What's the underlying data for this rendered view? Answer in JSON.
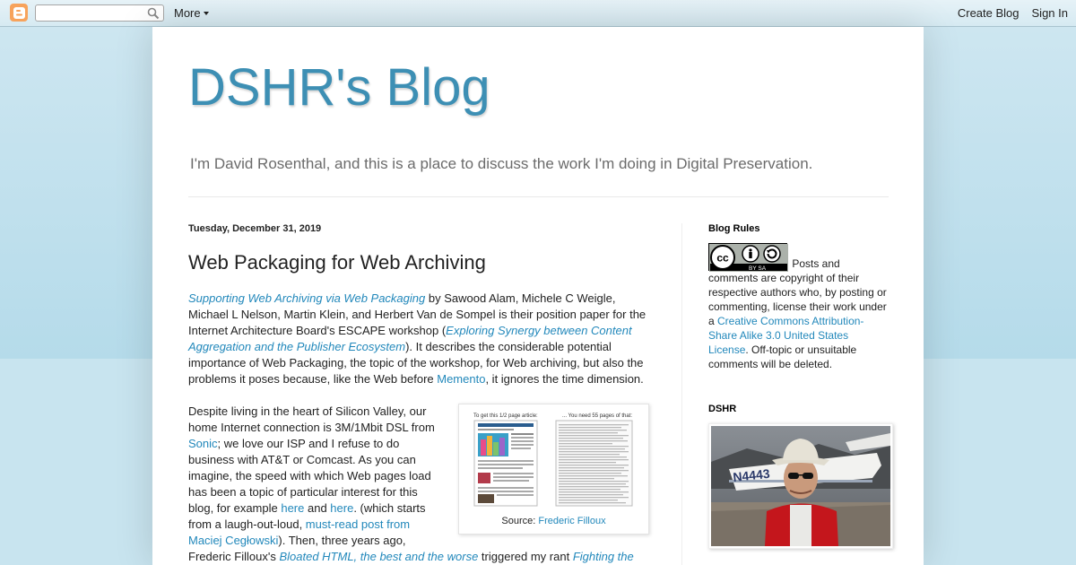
{
  "navbar": {
    "search_placeholder": "",
    "more_label": "More",
    "create_blog_label": "Create Blog",
    "sign_in_label": "Sign In"
  },
  "header": {
    "title": "DSHR's Blog",
    "description": "I'm David Rosenthal, and this is a place to discuss the work I'm doing in Digital Preservation."
  },
  "post": {
    "date": "Tuesday, December 31, 2019",
    "title": "Web Packaging for Web Archiving",
    "p1": {
      "link_title": "Supporting Web Archiving via Web Packaging",
      "t1": " by Sawood Alam, Michele C Weigle, Michael L Nelson, Martin Klein, and Herbert Van de Sompel is their position paper for the Internet Architecture Board's ESCAPE workshop (",
      "link_escape": "Exploring Synergy between Content Aggregation and the Publisher Ecosystem",
      "t2": "). It describes the considerable potential importance of Web Packaging, the topic of the workshop, for Web archiving, but also the problems it poses because, like the Web before ",
      "link_memento": "Memento",
      "t3": ", it ignores the time dimension."
    },
    "p2": {
      "t1": "Despite living in the heart of Silicon Valley, our home Internet connection is 3M/1Mbit DSL from ",
      "link_sonic": "Sonic",
      "t2": "; we love our ISP and I refuse to do business with AT&T or Comcast. As you can imagine, the speed with which Web pages load has been a topic of particular interest for this blog, for example ",
      "link_here1": "here",
      "t3": " and ",
      "link_here2": "here",
      "t4": ". (which starts from a laugh-out-loud, ",
      "link_maciej": "must-read post from Maciej Cegłowski",
      "t5": "). Then, three years ago, Frederic Filloux's ",
      "link_bloated": "Bloated HTML, the best and the worse",
      "t6": " triggered my rant ",
      "link_flab": "Fighting the Web Flab",
      "t7": ":"
    },
    "figure": {
      "left_label": "To get this 1/2 page article:",
      "right_label": "... You need 55 pages of that:",
      "caption_prefix": "Source: ",
      "caption_link": "Frederic Filloux"
    }
  },
  "sidebar": {
    "rules_heading": "Blog Rules",
    "cc_badge_text": "BY   SA",
    "rules_t1": " Posts and comments are copyright of their respective authors who, by posting or commenting, license their work under a ",
    "rules_link": "Creative Commons Attribution-Share Alike 3.0 United States License",
    "rules_t2": ". Off-topic or unsuitable comments will be deleted.",
    "dshr_heading": "DSHR",
    "plane_registration": "N4443"
  },
  "colors": {
    "title": "#3d8fb4",
    "link": "#2288bb",
    "background": "#c5e3ef"
  }
}
